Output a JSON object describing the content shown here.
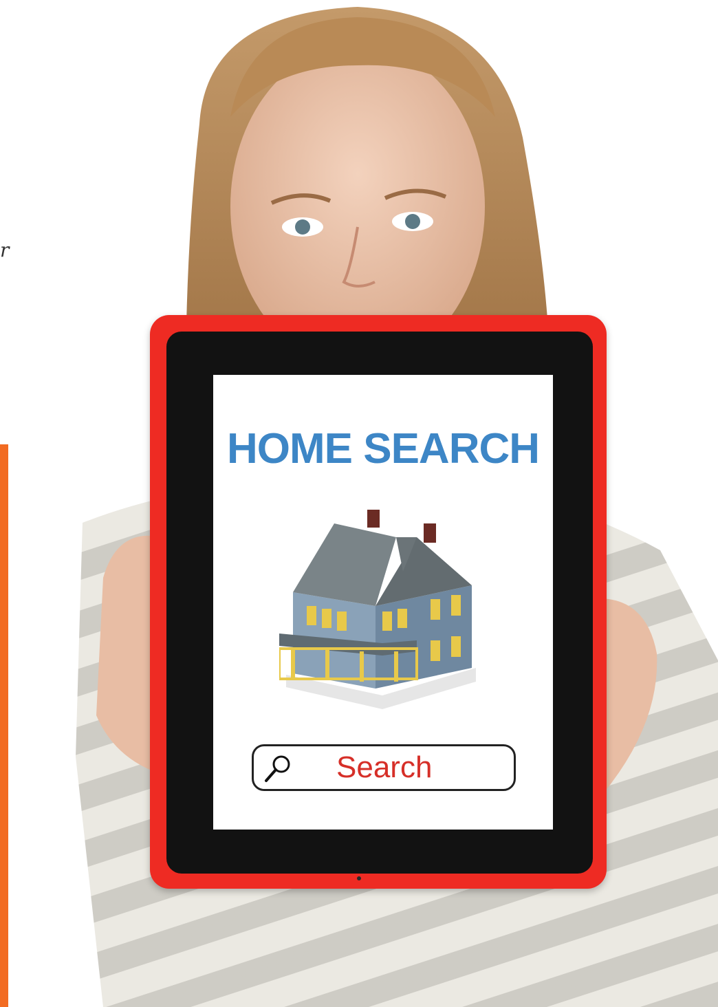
{
  "screen": {
    "title": "HOME SEARCH",
    "search_label": "Search"
  },
  "icons": {
    "search": "magnifier-icon",
    "house": "house-icon"
  },
  "colors": {
    "tablet_case": "#ee2b23",
    "title": "#3d86c6",
    "search_label": "#d62f28",
    "side_bar": "#f26b22"
  },
  "stray_text": "r"
}
